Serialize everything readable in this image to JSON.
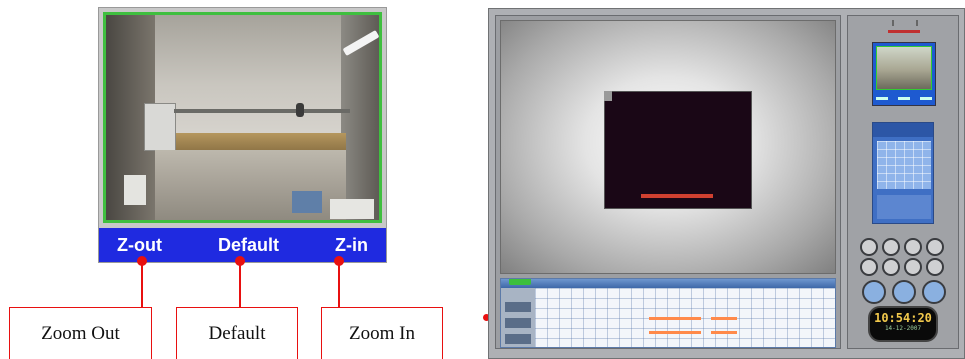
{
  "zoom_panel": {
    "buttons": [
      {
        "label": "Z-out"
      },
      {
        "label": "Default"
      },
      {
        "label": "Z-in"
      }
    ]
  },
  "callouts": [
    {
      "label": "Zoom Out"
    },
    {
      "label": "Default"
    },
    {
      "label": "Zoom In"
    }
  ],
  "dvr": {
    "clock": {
      "time": "10:54:20",
      "date": "14-12-2007"
    }
  },
  "colors": {
    "zoom_bar": "#1f2ae0",
    "callout": "#e81010",
    "preview_border": "#3fbf3f"
  }
}
